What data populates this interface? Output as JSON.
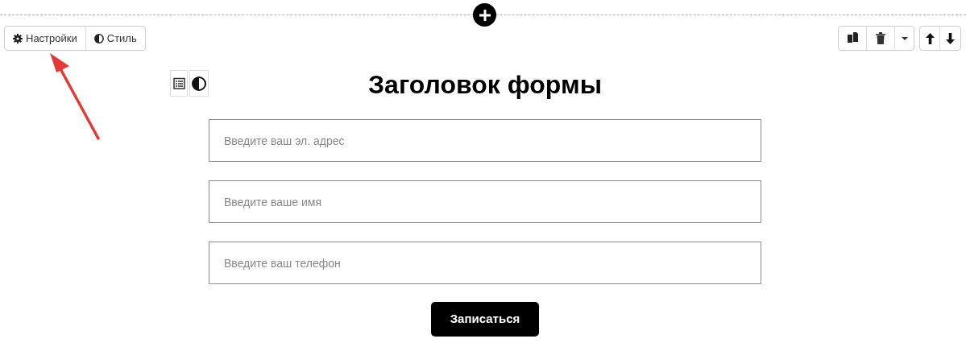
{
  "block_toolbar": {
    "buttons": [
      {
        "kind": "settings",
        "label": "Настройки"
      },
      {
        "kind": "style",
        "label": "Стиль"
      }
    ]
  },
  "form": {
    "title": "Заголовок формы",
    "fields": [
      {
        "placeholder": "Введите ваш эл. адрес"
      },
      {
        "placeholder": "Введите ваше имя"
      },
      {
        "placeholder": "Введите ваш телефон"
      }
    ],
    "submit": "Записаться"
  }
}
